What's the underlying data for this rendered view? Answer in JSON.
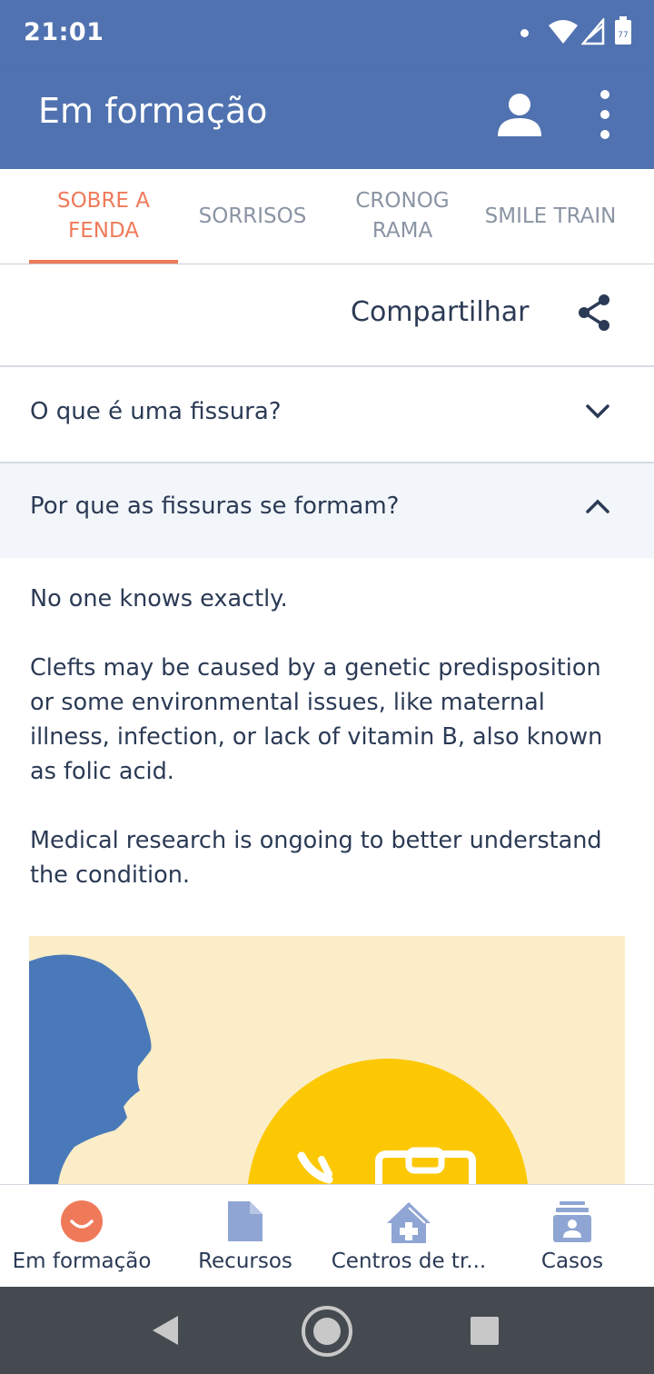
{
  "status_bar": {
    "time": "21:01",
    "battery_level": "77"
  },
  "app_bar": {
    "title": "Em formação",
    "account_icon": "person-icon",
    "menu_icon": "more-vert-icon"
  },
  "tabs": [
    {
      "label": "SOBRE A FENDA",
      "active": true
    },
    {
      "label": "SORRISOS",
      "active": false
    },
    {
      "label": "CRONOG RAMA",
      "active": false
    },
    {
      "label": "SMILE TRAIN",
      "active": false
    }
  ],
  "share": {
    "label": "Compartilhar",
    "icon": "share-icon"
  },
  "faq": [
    {
      "question": "O que é uma fissura?",
      "expanded": false
    },
    {
      "question": "Por que as fissuras se formam?",
      "expanded": true,
      "answer": [
        "No one knows exactly.",
        "Clefts may be caused by a genetic predisposition or some environmental issues, like maternal illness, infection, or lack of vitamin B, also known as folic acid.",
        "Medical research is ongoing to better understand the condition."
      ]
    }
  ],
  "bottom_nav": [
    {
      "label": "Em formação",
      "icon": "smile-icon",
      "active": true
    },
    {
      "label": "Recursos",
      "icon": "document-icon",
      "active": false
    },
    {
      "label": "Centros de tr...",
      "icon": "hospital-icon",
      "active": false
    },
    {
      "label": "Casos",
      "icon": "cases-icon",
      "active": false
    }
  ],
  "colors": {
    "primary": "#5072b0",
    "accent": "#ef7a5a",
    "text": "#2b3a55",
    "nav_icon_inactive": "#8fa5d3",
    "illustration_bg": "#fbedc8",
    "illustration_circle": "#fcc804",
    "illustration_head": "#4a79b9"
  }
}
